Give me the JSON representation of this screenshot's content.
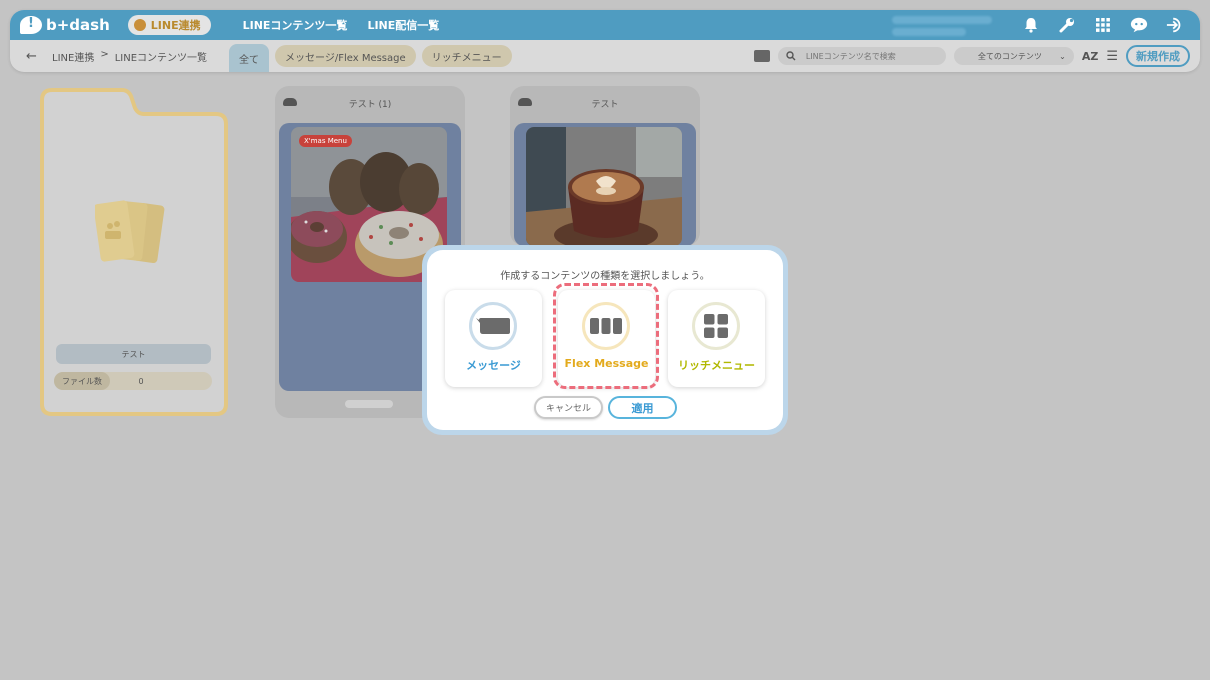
{
  "header": {
    "logo_text": "b+dash",
    "line_pill": "LINE連携",
    "nav": [
      "LINEコンテンツ一覧",
      "LINE配信一覧"
    ],
    "icons": [
      "bell-icon",
      "wrench-icon",
      "grid-icon",
      "support-chat-icon",
      "logout-icon"
    ]
  },
  "subbar": {
    "breadcrumb": [
      "LINE連携",
      ">",
      "LINEコンテンツ一覧"
    ],
    "tabs": [
      "全て",
      "メッセージ/Flex Message",
      "リッチメニュー"
    ],
    "active_tab": "全て",
    "search_placeholder": "LINEコンテンツ名で検索",
    "filter_value": "全てのコンテンツ",
    "sort_label": "AZ",
    "new_button": "新規作成"
  },
  "folder": {
    "name": "テスト",
    "count_label": "ファイル数",
    "count_value": "0"
  },
  "cards": [
    {
      "title": "テスト (1)",
      "badge": "X'mas Menu"
    },
    {
      "title": "テスト",
      "badge": ""
    }
  ],
  "modal": {
    "title": "作成するコンテンツの種類を選択しましょう。",
    "options": [
      "メッセージ",
      "Flex Message",
      "リッチメニュー"
    ],
    "selected_option": "Flex Message",
    "cancel": "キャンセル",
    "apply": "適用"
  },
  "colors": {
    "accent": "#4f9cc1",
    "message": "#3a9ad3",
    "flex": "#e3aa1c",
    "rich": "#b1b800",
    "highlight": "#ec6d7c"
  }
}
